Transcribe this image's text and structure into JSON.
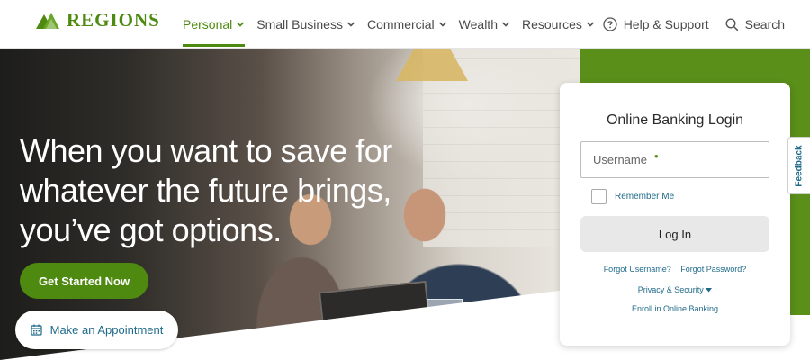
{
  "brand": {
    "name": "REGIONS",
    "color": "#4f8a10"
  },
  "nav": {
    "items": [
      {
        "label": "Personal",
        "active": true
      },
      {
        "label": "Small Business",
        "active": false
      },
      {
        "label": "Commercial",
        "active": false
      },
      {
        "label": "Wealth",
        "active": false
      },
      {
        "label": "Resources",
        "active": false
      }
    ]
  },
  "utility": {
    "help_label": "Help & Support",
    "help_icon": "question-circle-icon",
    "search_label": "Search",
    "search_icon": "magnifier-icon"
  },
  "hero": {
    "headline": "When you want to save for whatever the future brings, you’ve got options.",
    "primary_button": "Get Started Now",
    "secondary_button": "Make an Appointment",
    "secondary_icon": "calendar-icon"
  },
  "login": {
    "title": "Online Banking Login",
    "username_placeholder": "Username",
    "remember_label": "Remember Me",
    "login_button": "Log In",
    "forgot_username": "Forgot Username?",
    "forgot_password": "Forgot Password?",
    "privacy_label": "Privacy & Security",
    "enroll_label": "Enroll in Online Banking"
  },
  "feedback": {
    "label": "Feedback"
  },
  "colors": {
    "accent_green": "#4f8a10",
    "link_blue": "#1f6a8a",
    "band_green": "#5a8f1a"
  }
}
